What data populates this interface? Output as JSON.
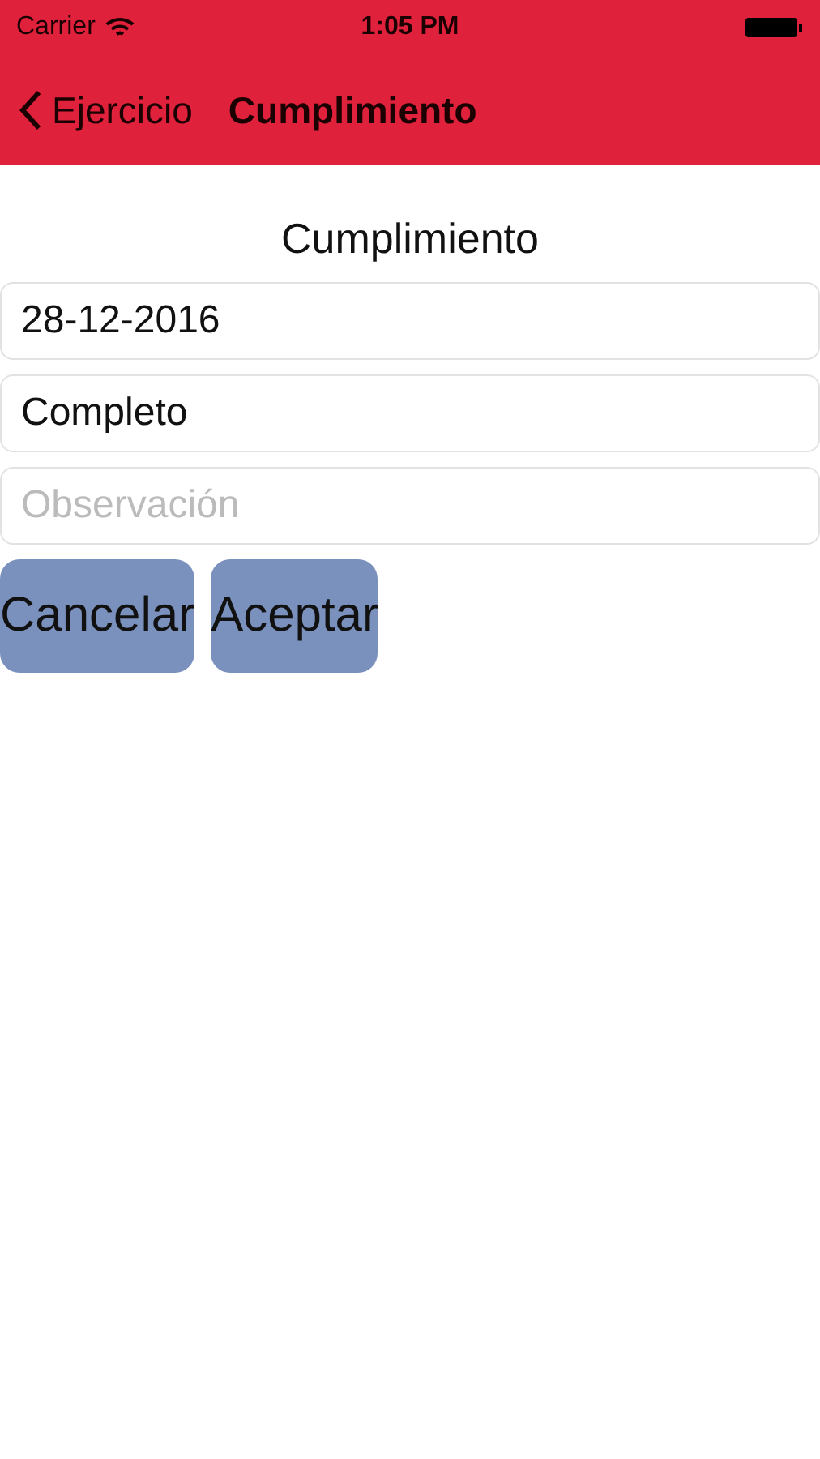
{
  "status_bar": {
    "carrier": "Carrier",
    "time": "1:05 PM"
  },
  "nav_bar": {
    "back_label": "Ejercicio",
    "title": "Cumplimiento"
  },
  "form": {
    "heading": "Cumplimiento",
    "fields": [
      {
        "value": "28-12-2016"
      },
      {
        "value": "Completo"
      },
      {
        "placeholder": "Observación"
      }
    ],
    "buttons": [
      "Cancelar",
      "Aceptar"
    ]
  }
}
